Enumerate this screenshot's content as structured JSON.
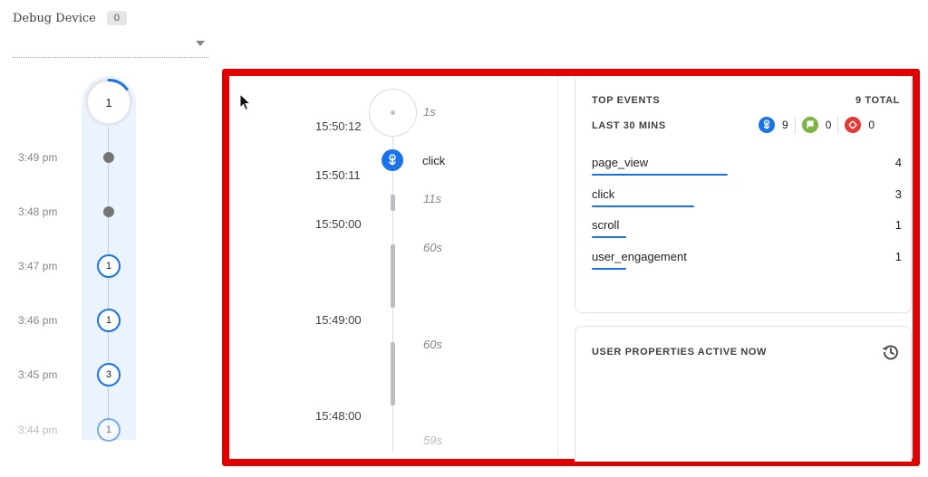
{
  "device": {
    "label": "Debug Device",
    "count": "0"
  },
  "minutes": {
    "top_count": "1",
    "rows": [
      {
        "time": "3:49 pm",
        "kind": "dot",
        "count": ""
      },
      {
        "time": "3:48 pm",
        "kind": "dot",
        "count": ""
      },
      {
        "time": "3:47 pm",
        "kind": "ring",
        "count": "1"
      },
      {
        "time": "3:46 pm",
        "kind": "ring",
        "count": "1"
      },
      {
        "time": "3:45 pm",
        "kind": "ring",
        "count": "3"
      },
      {
        "time": "3:44 pm",
        "kind": "ring",
        "count": "1"
      }
    ]
  },
  "stream": {
    "times": [
      "15:50:12",
      "15:50:11",
      "15:50:00",
      "15:49:00",
      "15:48:00"
    ],
    "gaps": [
      "1s",
      "11s",
      "60s",
      "60s",
      "59s"
    ],
    "event": {
      "name": "click",
      "icon": "touch-icon"
    }
  },
  "top_events": {
    "title": "TOP EVENTS",
    "total": "9 TOTAL",
    "window": "LAST 30 MINS",
    "counters": [
      {
        "icon": "touch-icon",
        "color": "#1a73e8",
        "value": "9"
      },
      {
        "icon": "flag-icon",
        "color": "#7cb342",
        "value": "0"
      },
      {
        "icon": "bug-icon",
        "color": "#e53935",
        "value": "0"
      }
    ],
    "items": [
      {
        "name": "page_view",
        "count": "4",
        "share": 0.44
      },
      {
        "name": "click",
        "count": "3",
        "share": 0.33
      },
      {
        "name": "scroll",
        "count": "1",
        "share": 0.11
      },
      {
        "name": "user_engagement",
        "count": "1",
        "share": 0.11
      }
    ]
  },
  "user_properties": {
    "title": "USER PROPERTIES ACTIVE NOW"
  },
  "colors": {
    "accent": "#1a73e8",
    "highlight_frame": "#e00000"
  }
}
